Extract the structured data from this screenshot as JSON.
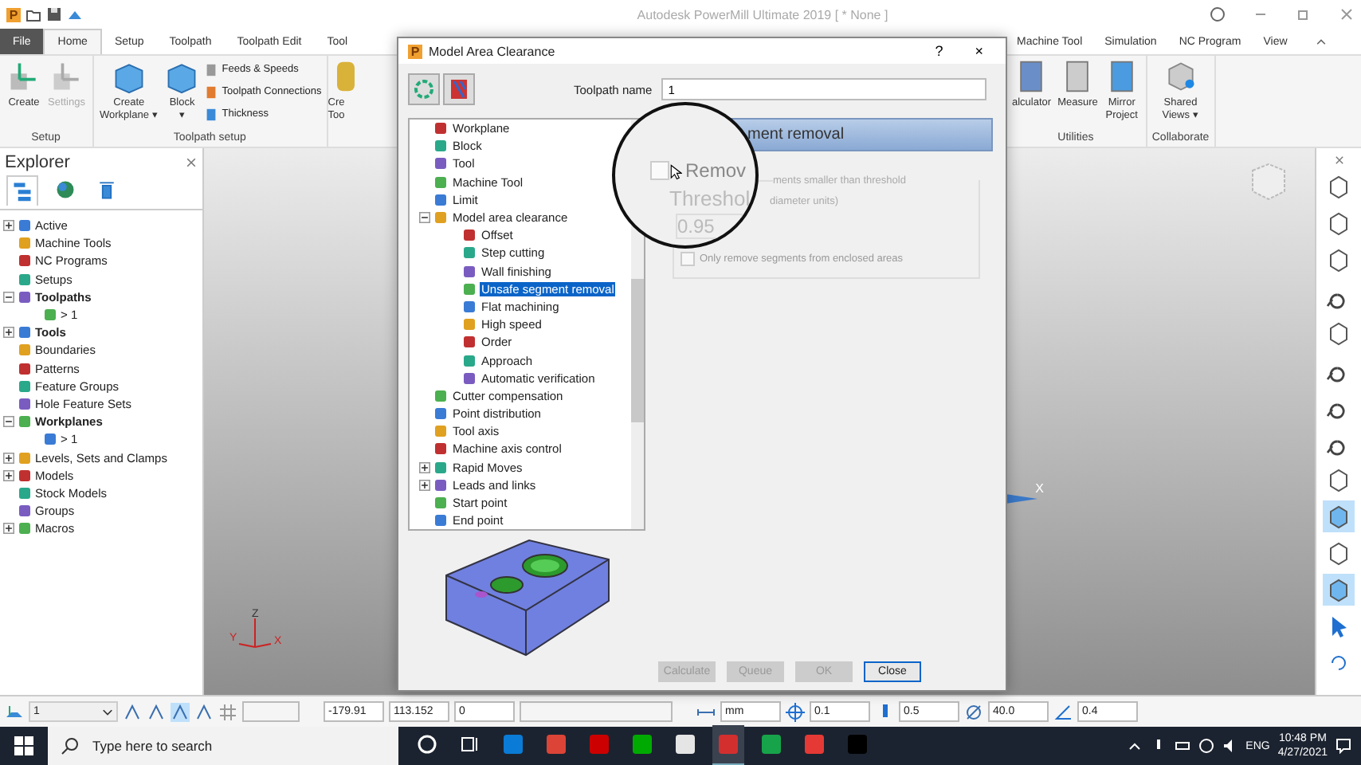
{
  "app": {
    "logo": "P",
    "title": "Autodesk PowerMill Ultimate 2019   [ * None ]"
  },
  "ribbon": {
    "tabs_left": [
      {
        "label": "File",
        "kind": "file",
        "selected": false
      },
      {
        "label": "Home",
        "kind": "tab",
        "selected": true
      },
      {
        "label": "Setup",
        "kind": "tab",
        "selected": false
      },
      {
        "label": "Toolpath",
        "kind": "tab",
        "selected": false
      },
      {
        "label": "Toolpath Edit",
        "kind": "tab",
        "selected": false
      },
      {
        "label": "Tool",
        "kind": "tab",
        "selected": false
      }
    ],
    "tabs_right": [
      {
        "label": "Machine Tool",
        "selected": false
      },
      {
        "label": "Simulation",
        "selected": false
      },
      {
        "label": "NC Program",
        "selected": false
      },
      {
        "label": "View",
        "selected": false
      }
    ],
    "setup_group": {
      "title": "Setup",
      "buttons": [
        {
          "label": "Create",
          "disabled": false
        },
        {
          "label": "Settings",
          "disabled": true
        }
      ]
    },
    "toolpath_setup_group": {
      "title": "Toolpath setup",
      "large": [
        {
          "lines": [
            "Create",
            "Workplane ▾"
          ]
        },
        {
          "lines": [
            "Block",
            "▾"
          ]
        }
      ],
      "small": [
        "Feeds & Speeds",
        "Toolpath Connections",
        "Thickness"
      ]
    },
    "cut_group": {
      "lines": [
        "Cre",
        "Too"
      ]
    },
    "utilities_group": {
      "title": "Utilities",
      "buttons": [
        {
          "lines": [
            "alculator"
          ]
        },
        {
          "lines": [
            "Measure"
          ]
        },
        {
          "lines": [
            "Mirror",
            "Project"
          ]
        }
      ]
    },
    "collaborate_group": {
      "title": "Collaborate",
      "buttons": [
        {
          "lines": [
            "Shared",
            "Views ▾"
          ]
        }
      ]
    }
  },
  "explorer": {
    "title": "Explorer",
    "items": [
      {
        "label": "Active",
        "expanded": false,
        "bold": false
      },
      {
        "label": "Machine Tools",
        "bold": false
      },
      {
        "label": "NC Programs",
        "bold": false
      },
      {
        "label": "Setups",
        "bold": false
      },
      {
        "label": "Toolpaths",
        "expanded": true,
        "bold": true,
        "children": [
          {
            "label": "> 1",
            "bold": false
          }
        ]
      },
      {
        "label": "Tools",
        "expanded": false,
        "bold": true
      },
      {
        "label": "Boundaries",
        "bold": false
      },
      {
        "label": "Patterns",
        "bold": false
      },
      {
        "label": "Feature Groups",
        "bold": false
      },
      {
        "label": "Hole Feature Sets",
        "bold": false
      },
      {
        "label": "Workplanes",
        "expanded": true,
        "bold": true,
        "children": [
          {
            "label": "> 1",
            "bold": false
          }
        ]
      },
      {
        "label": "Levels, Sets and Clamps",
        "expanded": false,
        "bold": false
      },
      {
        "label": "Models",
        "expanded": false,
        "bold": false
      },
      {
        "label": "Stock Models",
        "bold": false
      },
      {
        "label": "Groups",
        "bold": false
      },
      {
        "label": "Macros",
        "expanded": false,
        "bold": false
      }
    ]
  },
  "viewport": {
    "axis_label": "X",
    "triad": {
      "x": "X",
      "y": "Y",
      "z": "Z"
    }
  },
  "dialog": {
    "logo": "P",
    "title": "Model Area Clearance",
    "help": "?",
    "close": "×",
    "toolpath_name_label": "Toolpath name",
    "toolpath_name": "1",
    "tree": [
      {
        "label": "Workplane",
        "selected": false
      },
      {
        "label": "Block",
        "selected": false
      },
      {
        "label": "Tool",
        "selected": false
      },
      {
        "label": "Machine Tool",
        "selected": false
      },
      {
        "label": "Limit",
        "selected": false
      },
      {
        "label": "Model area clearance",
        "selected": false,
        "expanded": true,
        "children": [
          {
            "label": "Offset",
            "selected": false
          },
          {
            "label": "Step cutting",
            "selected": false
          },
          {
            "label": "Wall finishing",
            "selected": false
          },
          {
            "label": "Unsafe segment removal",
            "selected": true
          },
          {
            "label": "Flat machining",
            "selected": false
          },
          {
            "label": "High speed",
            "selected": false
          },
          {
            "label": "Order",
            "selected": false
          },
          {
            "label": "Approach",
            "selected": false
          },
          {
            "label": "Automatic verification",
            "selected": false
          }
        ]
      },
      {
        "label": "Cutter compensation",
        "selected": false
      },
      {
        "label": "Point distribution",
        "selected": false
      },
      {
        "label": "Tool axis",
        "selected": false
      },
      {
        "label": "Machine axis control",
        "selected": false
      },
      {
        "label": "Rapid Moves",
        "selected": false,
        "expanded": false
      },
      {
        "label": "Leads and links",
        "selected": false,
        "expanded": false
      },
      {
        "label": "Start point",
        "selected": false
      },
      {
        "label": "End point",
        "selected": false
      }
    ],
    "panel": {
      "header": "ment removal",
      "option_text": "ments smaller than threshold",
      "units_text": "diameter units)",
      "enclosed_text": "Only remove segments from enclosed areas",
      "enclosed_checked": false
    },
    "magnifier": {
      "option_text": "Remov",
      "option_checked": false,
      "threshold_label": "Threshol",
      "threshold_value": "0.95"
    },
    "buttons": [
      {
        "label": "Calculate",
        "disabled": true
      },
      {
        "label": "Queue",
        "disabled": true
      },
      {
        "label": "OK",
        "disabled": true
      },
      {
        "label": "Close",
        "disabled": false
      }
    ]
  },
  "status_toolbar": {
    "workplane": "1",
    "fields": [
      {
        "kind": "coord",
        "value": "-179.91"
      },
      {
        "kind": "coord",
        "value": "113.152"
      },
      {
        "kind": "coord",
        "value": "0"
      },
      {
        "kind": "gap"
      },
      {
        "kind": "units",
        "value": "mm"
      },
      {
        "kind": "target",
        "value": "0.1"
      },
      {
        "kind": "tol",
        "value": "0.5"
      },
      {
        "kind": "dia",
        "value": "40.0"
      },
      {
        "kind": "angle",
        "value": "0.4"
      }
    ]
  },
  "taskbar": {
    "search_placeholder": "Type here to search",
    "language": "ENG",
    "time": "10:48 PM",
    "date": "4/27/2021"
  }
}
